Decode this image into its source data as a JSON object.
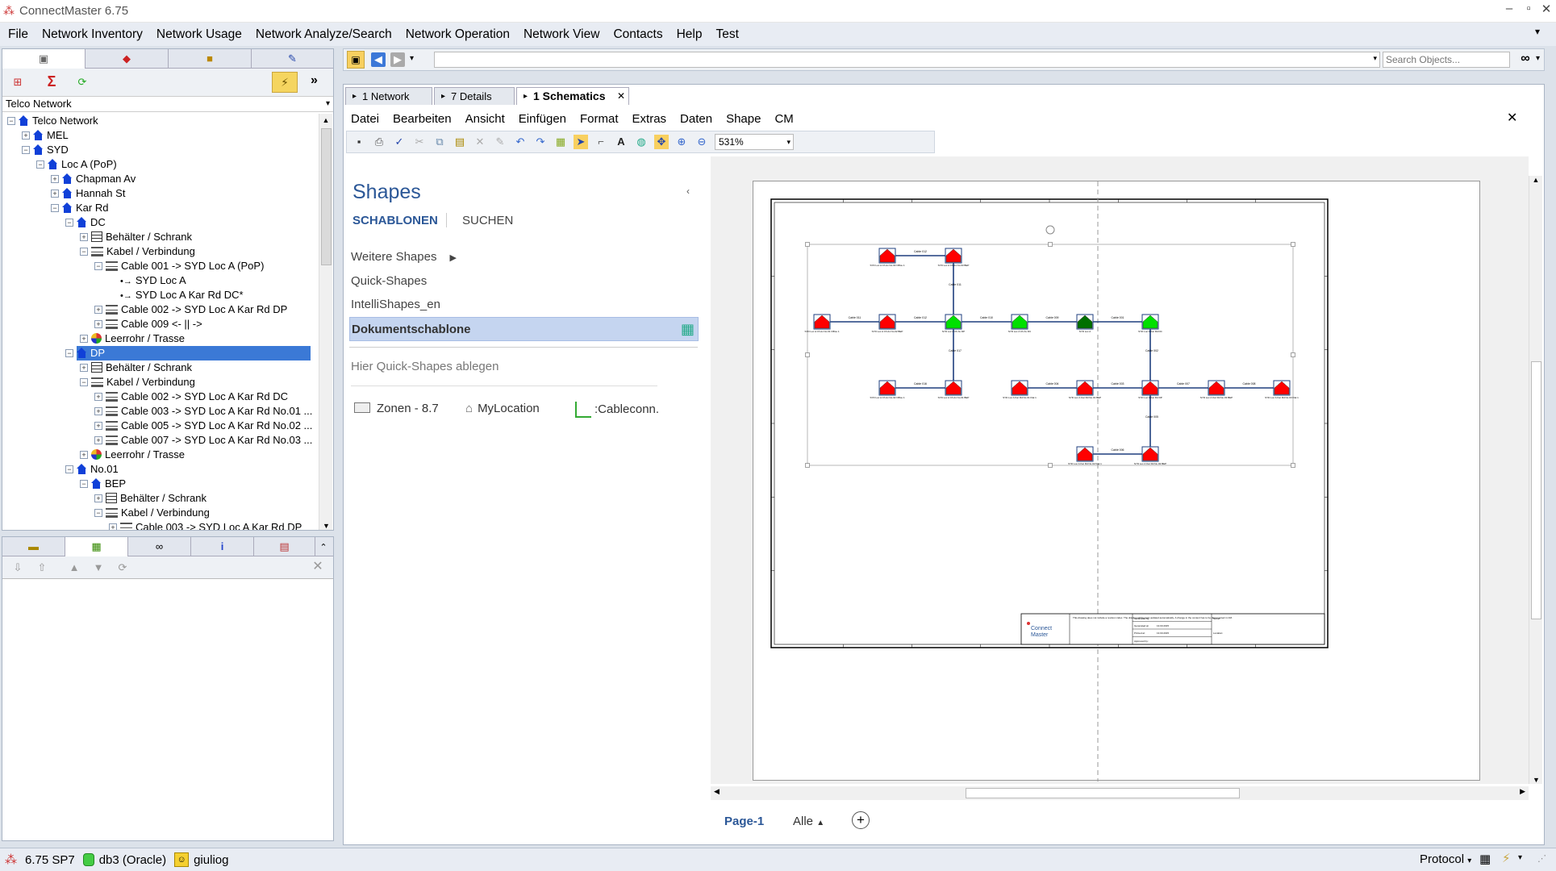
{
  "app": {
    "title": "ConnectMaster 6.75"
  },
  "menu": [
    "File",
    "Network Inventory",
    "Network Usage",
    "Network Analyze/Search",
    "Network Operation",
    "Network View",
    "Contacts",
    "Help",
    "Test"
  ],
  "top_toolbar": {
    "search_placeholder": "Search Objects...",
    "address_value": ""
  },
  "left": {
    "selector": "Telco Network",
    "tree": [
      {
        "label": "Telco Network",
        "lvl": 0,
        "icon": "house",
        "pm": "-"
      },
      {
        "label": "MEL",
        "lvl": 1,
        "icon": "house",
        "pm": "+"
      },
      {
        "label": "SYD",
        "lvl": 1,
        "icon": "house",
        "pm": "-"
      },
      {
        "label": "Loc A (PoP)",
        "lvl": 2,
        "icon": "house",
        "pm": "-"
      },
      {
        "label": "Chapman Av",
        "lvl": 3,
        "icon": "house",
        "pm": "+"
      },
      {
        "label": "Hannah St",
        "lvl": 3,
        "icon": "house",
        "pm": "+"
      },
      {
        "label": "Kar Rd",
        "lvl": 3,
        "icon": "house",
        "pm": "-"
      },
      {
        "label": "DC",
        "lvl": 4,
        "icon": "house",
        "pm": "-"
      },
      {
        "label": "Behälter / Schrank",
        "lvl": 5,
        "icon": "box",
        "pm": "+"
      },
      {
        "label": "Kabel / Verbindung",
        "lvl": 5,
        "icon": "cab",
        "pm": "-"
      },
      {
        "label": "Cable 001 -> SYD Loc A (PoP)",
        "lvl": 6,
        "icon": "cab",
        "pm": "-"
      },
      {
        "label": "SYD Loc A",
        "lvl": 7,
        "icon": "arrow",
        "pm": ""
      },
      {
        "label": "SYD Loc A Kar Rd DC*",
        "lvl": 7,
        "icon": "arrow",
        "pm": ""
      },
      {
        "label": "Cable 002 -> SYD Loc A Kar Rd DP",
        "lvl": 6,
        "icon": "cab",
        "pm": "+"
      },
      {
        "label": "Cable 009 <- || ->",
        "lvl": 6,
        "icon": "cab",
        "pm": "+"
      },
      {
        "label": "Leerrohr / Trasse",
        "lvl": 5,
        "icon": "duct",
        "pm": "+"
      },
      {
        "label": "DP",
        "lvl": 4,
        "icon": "house",
        "pm": "-",
        "selected": true
      },
      {
        "label": "Behälter / Schrank",
        "lvl": 5,
        "icon": "box",
        "pm": "+"
      },
      {
        "label": "Kabel / Verbindung",
        "lvl": 5,
        "icon": "cab",
        "pm": "-"
      },
      {
        "label": "Cable 002 -> SYD Loc A Kar Rd DC",
        "lvl": 6,
        "icon": "cab",
        "pm": "+"
      },
      {
        "label": "Cable 003 -> SYD Loc A Kar Rd No.01 ...",
        "lvl": 6,
        "icon": "cab",
        "pm": "+"
      },
      {
        "label": "Cable 005 -> SYD Loc A Kar Rd No.02 ...",
        "lvl": 6,
        "icon": "cab",
        "pm": "+"
      },
      {
        "label": "Cable 007 -> SYD Loc A Kar Rd No.03 ...",
        "lvl": 6,
        "icon": "cab",
        "pm": "+"
      },
      {
        "label": "Leerrohr / Trasse",
        "lvl": 5,
        "icon": "duct",
        "pm": "+"
      },
      {
        "label": "No.01",
        "lvl": 4,
        "icon": "house",
        "pm": "-"
      },
      {
        "label": "BEP",
        "lvl": 5,
        "icon": "house",
        "pm": "-"
      },
      {
        "label": "Behälter / Schrank",
        "lvl": 6,
        "icon": "box",
        "pm": "+"
      },
      {
        "label": "Kabel / Verbindung",
        "lvl": 6,
        "icon": "cab",
        "pm": "-"
      },
      {
        "label": "Cable 003 -> SYD Loc A Kar Rd DP",
        "lvl": 7,
        "icon": "cab",
        "pm": "+"
      }
    ]
  },
  "doc_tabs": [
    {
      "label": "1 Network"
    },
    {
      "label": "7 Details"
    },
    {
      "label": "1 Schematics",
      "active": true
    }
  ],
  "visio_menu": [
    "Datei",
    "Bearbeiten",
    "Ansicht",
    "Einfügen",
    "Format",
    "Extras",
    "Daten",
    "Shape",
    "CM"
  ],
  "zoom": "531%",
  "shapes": {
    "title": "Shapes",
    "tab1": "SCHABLONEN",
    "tab2": "SUCHEN",
    "items": [
      "Weitere Shapes",
      "Quick-Shapes",
      "IntelliShapes_en",
      "Dokumentschablone"
    ],
    "hint": "Hier Quick-Shapes ablegen",
    "stencils": [
      "Zonen - 8.7",
      "MyLocation",
      ":Cableconn."
    ]
  },
  "page": {
    "tab": "Page-1",
    "all": "Alle"
  },
  "title_block": {
    "logo1": "Connect",
    "logo2": "Master",
    "note": "This drawing does not include a revision index. The drawing will be kept updated automatically. A change in the content has to be documented in CM.",
    "gen_by": "Generated by:",
    "gen_at": "Generated at:",
    "gen_date": "13.03.2015",
    "printed": "Printed at:",
    "print_date": "13.03.2015",
    "approved": "Approved by:",
    "name": "Name:",
    "location": "Location:"
  },
  "status": {
    "version": "6.75 SP7",
    "db": "db3 (Oracle)",
    "user": "giuliog",
    "protocol": "Protocol"
  },
  "diagram": {
    "nodes": [
      {
        "id": "n1",
        "label": "SYD Loc A Ch Av No.03 Office 1",
        "color": "#ff0000"
      },
      {
        "id": "n2",
        "label": "SYD Loc A Ch Av No.03 BEP",
        "color": "#ff0000"
      },
      {
        "id": "n3",
        "label": "SYD Loc A Ch Av No.01 Office 1",
        "color": "#ff0000"
      },
      {
        "id": "n4",
        "label": "SYD Loc A Ch Av No.02 BEP",
        "color": "#ff0000"
      },
      {
        "id": "n5",
        "label": "SYD Loc A Ch Av DP",
        "color": "#00e000"
      },
      {
        "id": "n6",
        "label": "SYD Loc A Ch Av DC",
        "color": "#00e000"
      },
      {
        "id": "n7",
        "label": "SYD Loc A",
        "color": "#007000"
      },
      {
        "id": "n8",
        "label": "SYD Loc A Kar Rd DC",
        "color": "#00e000"
      },
      {
        "id": "n9",
        "label": "SYD Loc A Ch Av No.02 Office 1",
        "color": "#ff0000"
      },
      {
        "id": "n10",
        "label": "SYD Loc A Ch Av No.01 BEP",
        "color": "#ff0000"
      },
      {
        "id": "n11",
        "label": "SYD Loc A Kar Rd No.01 Flat 1",
        "color": "#ff0000"
      },
      {
        "id": "n12",
        "label": "SYD Loc A Kar Rd No.01 BEP",
        "color": "#ff0000"
      },
      {
        "id": "n13",
        "label": "SYD Loc A Kar Rd DP",
        "color": "#ff0000"
      },
      {
        "id": "n14",
        "label": "SYD Loc A Kar Rd No.03 BEP",
        "color": "#ff0000"
      },
      {
        "id": "n15",
        "label": "SYD Loc A Kar Rd No.03 Flat 1",
        "color": "#ff0000"
      },
      {
        "id": "n16",
        "label": "SYD Loc A Kar Rd No.02 Flat 1",
        "color": "#ff0000"
      },
      {
        "id": "n17",
        "label": "SYD Loc A Kar Rd No.02 BEP",
        "color": "#ff0000"
      }
    ],
    "edges": [
      {
        "from": "n1",
        "to": "n2",
        "label": "Cable 012"
      },
      {
        "from": "n3",
        "to": "n4",
        "label": "Cable 011"
      },
      {
        "from": "n4",
        "to": "n5",
        "label": "Cable 012"
      },
      {
        "from": "n5",
        "to": "n6",
        "label": "Cable 010"
      },
      {
        "from": "n6",
        "to": "n7",
        "label": "Cable 009"
      },
      {
        "from": "n7",
        "to": "n8",
        "label": "Cable 001"
      },
      {
        "from": "n2",
        "to": "n5",
        "label": "Cable 011"
      },
      {
        "from": "n5",
        "to": "n10",
        "label": "Cable 017"
      },
      {
        "from": "n9",
        "to": "n10",
        "label": "Cable 016"
      },
      {
        "from": "n8",
        "to": "n13",
        "label": "Cable 002"
      },
      {
        "from": "n11",
        "to": "n12",
        "label": "Cable 004"
      },
      {
        "from": "n12",
        "to": "n13",
        "label": "Cable 003"
      },
      {
        "from": "n13",
        "to": "n14",
        "label": "Cable 007"
      },
      {
        "from": "n14",
        "to": "n15",
        "label": "Cable 008"
      },
      {
        "from": "n13",
        "to": "n17",
        "label": "Cable 005"
      },
      {
        "from": "n16",
        "to": "n17",
        "label": "Cable 006"
      }
    ]
  }
}
